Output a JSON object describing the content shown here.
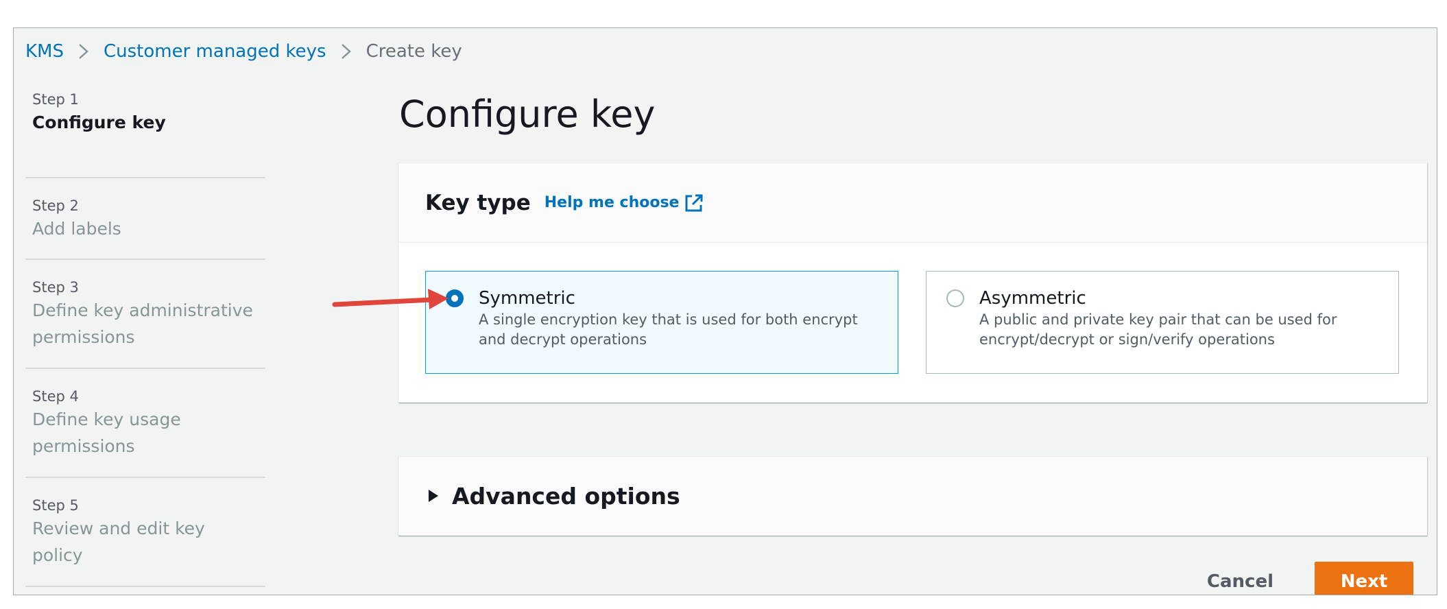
{
  "breadcrumb": {
    "items": [
      {
        "label": "KMS"
      },
      {
        "label": "Customer managed keys"
      },
      {
        "label": "Create key"
      }
    ]
  },
  "steps": [
    {
      "number": "Step 1",
      "title": "Configure key",
      "active": true
    },
    {
      "number": "Step 2",
      "title": "Add labels",
      "active": false
    },
    {
      "number": "Step 3",
      "title": "Define key administrative permissions",
      "active": false
    },
    {
      "number": "Step 4",
      "title": "Define key usage permissions",
      "active": false
    },
    {
      "number": "Step 5",
      "title": "Review and edit key policy",
      "active": false
    }
  ],
  "main": {
    "title": "Configure key",
    "key_type": {
      "heading": "Key type",
      "help_link": "Help me choose",
      "options": [
        {
          "label": "Symmetric",
          "description": "A single encryption key that is used for both encrypt and decrypt operations",
          "selected": true
        },
        {
          "label": "Asymmetric",
          "description": "A public and private key pair that can be used for encrypt/decrypt or sign/verify operations",
          "selected": false
        }
      ]
    },
    "advanced": {
      "label": "Advanced options",
      "expanded": false
    }
  },
  "actions": {
    "cancel_label": "Cancel",
    "next_label": "Next"
  },
  "icons": {
    "breadcrumb_separator": "chevron-right-icon",
    "help_link": "external-link-icon",
    "advanced_toggle": "caret-right-icon",
    "annotation": "red-arrow-icon"
  },
  "colors": {
    "link": "#0073bb",
    "primary_button": "#ec7211",
    "selected_tile_border": "#00a1c9",
    "selected_tile_bg": "#f1faff",
    "radio_selected": "#0073bb",
    "annotation_arrow": "#e0443a"
  }
}
